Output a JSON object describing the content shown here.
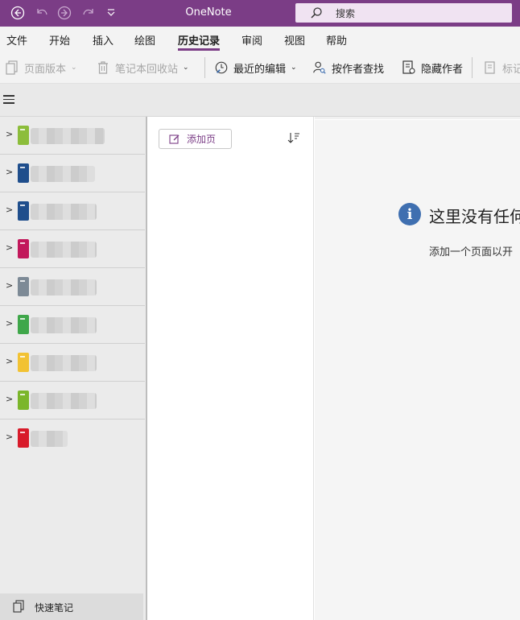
{
  "app": {
    "title": "OneNote",
    "accent": "#7b3d86"
  },
  "search": {
    "placeholder": "搜索"
  },
  "menu": {
    "tabs": [
      {
        "label": "文件"
      },
      {
        "label": "开始"
      },
      {
        "label": "插入"
      },
      {
        "label": "绘图"
      },
      {
        "label": "历史记录",
        "active": true
      },
      {
        "label": "审阅"
      },
      {
        "label": "视图"
      },
      {
        "label": "帮助"
      }
    ]
  },
  "ribbon": {
    "page_versions": "页面版本",
    "recycle_bin": "笔记本回收站",
    "recent_edits": "最近的编辑",
    "find_by_author": "按作者查找",
    "hide_authors": "隐藏作者",
    "mark_read": "标记"
  },
  "notebooks": [
    {
      "color": "#8cbd3b"
    },
    {
      "color": "#1f4e8c"
    },
    {
      "color": "#1f4e8c"
    },
    {
      "color": "#c2185b"
    },
    {
      "color": "#7d8a96"
    },
    {
      "color": "#3fa74a"
    },
    {
      "color": "#f2c233"
    },
    {
      "color": "#7bb62b"
    },
    {
      "color": "#d81b2a"
    }
  ],
  "quick_notes": {
    "label": "快速笔记"
  },
  "pages": {
    "add_page": "添加页"
  },
  "empty_state": {
    "title": "这里没有任何",
    "subtitle": "添加一个页面以开"
  }
}
